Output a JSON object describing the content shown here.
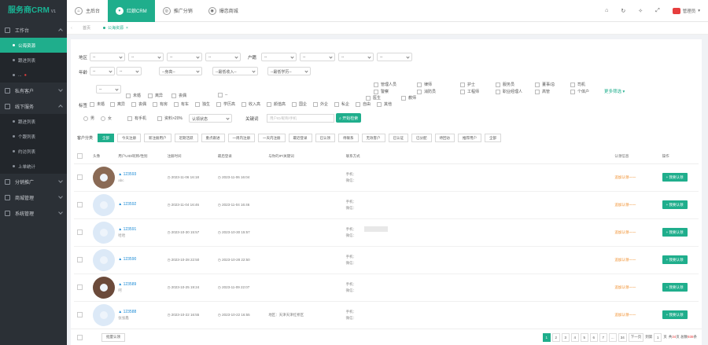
{
  "app": {
    "brand": "服务商CRM",
    "version": "V1"
  },
  "sidebar": {
    "items": [
      {
        "label": "工作台",
        "open": true,
        "sub": [
          {
            "label": "公海资源",
            "active": true
          },
          {
            "label": "跟进列表"
          },
          {
            "label": "..."
          }
        ]
      },
      {
        "label": "私有客户"
      },
      {
        "label": "线下服务",
        "open": true,
        "sub": [
          {
            "label": "跟进列表"
          },
          {
            "label": "个跟列表"
          },
          {
            "label": "约访列表"
          },
          {
            "label": "上单统计"
          }
        ]
      },
      {
        "label": "分销推广"
      },
      {
        "label": "商城管理"
      },
      {
        "label": "系统管理"
      }
    ]
  },
  "topbar": {
    "tabs": [
      {
        "label": "主后台",
        "icon": "home-icon"
      },
      {
        "label": "红娘CRM",
        "icon": "heart-icon",
        "active": true
      },
      {
        "label": "推广分销",
        "icon": "share-icon"
      },
      {
        "label": "爆恋商城",
        "icon": "shop-icon"
      }
    ],
    "user": "管理员"
  },
  "breadcrumbs": [
    "首页",
    "公海资源"
  ],
  "filters": {
    "region_label": "地区",
    "huji_label": "户籍",
    "age_label": "年龄",
    "select_placeholder": "--",
    "height_placeholder": "--身高--",
    "income_placeholder": "--最低收入--",
    "edu_placeholder": "--最低学历--",
    "marriage_opts": [
      "--",
      "未婚",
      "离异",
      "丧偶"
    ],
    "job_opts": [
      "管理人员",
      "警察",
      "律师",
      "消防员",
      "医生",
      "教师",
      "护士",
      "工程师",
      "服务员",
      "职业经理人",
      "董事/总",
      "高管",
      "司机",
      "个体户"
    ],
    "more_label": "更多筛选",
    "tag_label": "标签",
    "tags": [
      "未婚",
      "离异",
      "丧偶",
      "有房",
      "有车",
      "独生",
      "学历高",
      "收入高",
      "颜值高",
      "国企",
      "外企",
      "私企",
      "自由",
      "其他"
    ],
    "radio": [
      "男",
      "女"
    ],
    "has_phone": "有手机",
    "fill_rate": "资料>20%",
    "status_placeholder": "认领状态",
    "search_label": "关键词",
    "search_placeholder": "用户ID/昵称/手机",
    "search_btn": "开始检索"
  },
  "actions": {
    "caption": "客户分类",
    "buttons": [
      "全部",
      "今天注册",
      "新注册用户",
      "近期活跃",
      "重点跟进",
      "一周内注册",
      "一天内注册",
      "最近登录",
      "已认领",
      "待联系",
      "无效客户",
      "已认证",
      "已分配",
      "待回访",
      "推荐用户",
      "全部"
    ]
  },
  "table": {
    "headers": [
      "头像",
      "用户UID/昵称/性别",
      "注册时间",
      "最后登录",
      "与你的IP/关键词",
      "联系方式",
      "",
      "认领信息",
      "操作"
    ],
    "rows": [
      {
        "uid": "123593",
        "nick": "abc",
        "reg": "2023-11-06 16:18",
        "login": "2023-11-06 16:04",
        "ipinfo": "",
        "photo": true,
        "status": "追加认领一一",
        "op": "+ 我要认领"
      },
      {
        "uid": "123592",
        "nick": "",
        "reg": "2023-11-04 16:46",
        "login": "2023-11-04 16:46",
        "ipinfo": "",
        "photo": false,
        "status": "追加认领一一",
        "op": "+ 我要认领"
      },
      {
        "uid": "123591",
        "nick": "哈哈",
        "reg": "2023-10-30 15:57",
        "login": "2023-10-30 15:57",
        "ipinfo": "",
        "photo": false,
        "status": "追加认领一一",
        "op": "+ 我要认领",
        "masked": true
      },
      {
        "uid": "123590",
        "nick": "",
        "reg": "2023-10-28 22:50",
        "login": "2023-10-28 22:50",
        "ipinfo": "",
        "photo": false,
        "status": "追加认领一一",
        "op": "+ 我要认领"
      },
      {
        "uid": "123589",
        "nick": "呵",
        "reg": "2023-10-25 19:24",
        "login": "2023-11-09 22:07",
        "ipinfo": "",
        "photo": true,
        "status": "追加认领一一",
        "op": "+ 我要认领"
      },
      {
        "uid": "123588",
        "nick": "张张鑫",
        "reg": "2023-10-22 16:55",
        "login": "2023-10-22 16:55",
        "ipinfo": "地区：天津天津红桥区",
        "photo": false,
        "status": "追加认领一一",
        "op": "+ 我要认领"
      }
    ],
    "phone_label": "手机：",
    "wechat_label": "微信："
  },
  "footer": {
    "bulk": "批量认领",
    "pages": [
      "1",
      "2",
      "3",
      "4",
      "5",
      "6",
      "7",
      "...",
      "34"
    ],
    "next": "下一页",
    "goto": "到第",
    "page_input": "1",
    "page_unit": "页",
    "summary_prefix": "共",
    "total_pages": "34",
    "summary_mid": "页 总数",
    "total_count": "938",
    "summary_suffix": "条"
  }
}
